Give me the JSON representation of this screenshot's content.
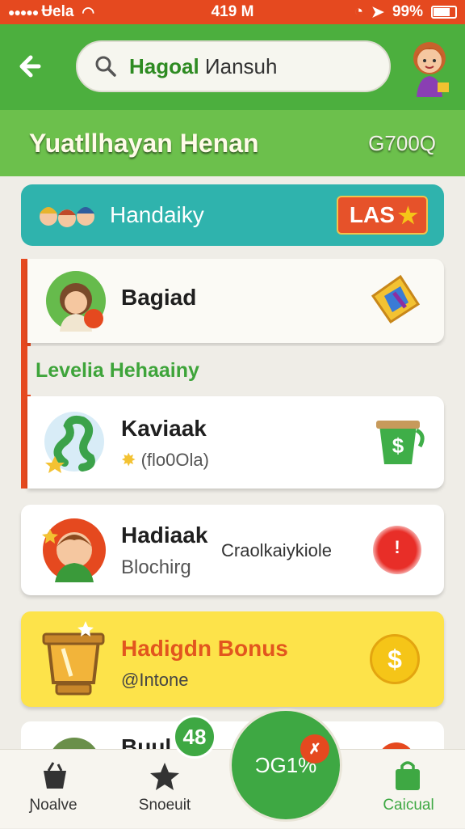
{
  "status": {
    "carrier": "Ʉela",
    "time": "419 M",
    "battery": "99%"
  },
  "header": {
    "search_highlight": "Hagoal",
    "search_rest": "Иansuh"
  },
  "subheader": {
    "title": "Yuatllhayan Henan",
    "value": "G700Q"
  },
  "banner": {
    "label": "Handaiky",
    "badge": "LAS"
  },
  "cards": [
    {
      "name": "Bagiad"
    },
    {
      "name": "Kaviaak",
      "sub": "(flo0Ola)"
    },
    {
      "name": "Hadiaak",
      "sub": "Blochirg",
      "status": "Craolkaiykiole"
    },
    {
      "name": "Hadigdn Bonus",
      "sub": "@Intone"
    }
  ],
  "section_title": "Levelia Hehaainy",
  "partial_card": {
    "name": "Buul"
  },
  "mini_badge": "48",
  "fab": {
    "label": "ƆG1%"
  },
  "nav": [
    {
      "label": "Ɲoalve"
    },
    {
      "label": "Snoeuit"
    },
    {
      "label": "Caicual"
    }
  ],
  "colors": {
    "primary": "#4caf3e",
    "accent": "#e5491f",
    "teal": "#2fb3ad",
    "bonus": "#fde34a"
  }
}
